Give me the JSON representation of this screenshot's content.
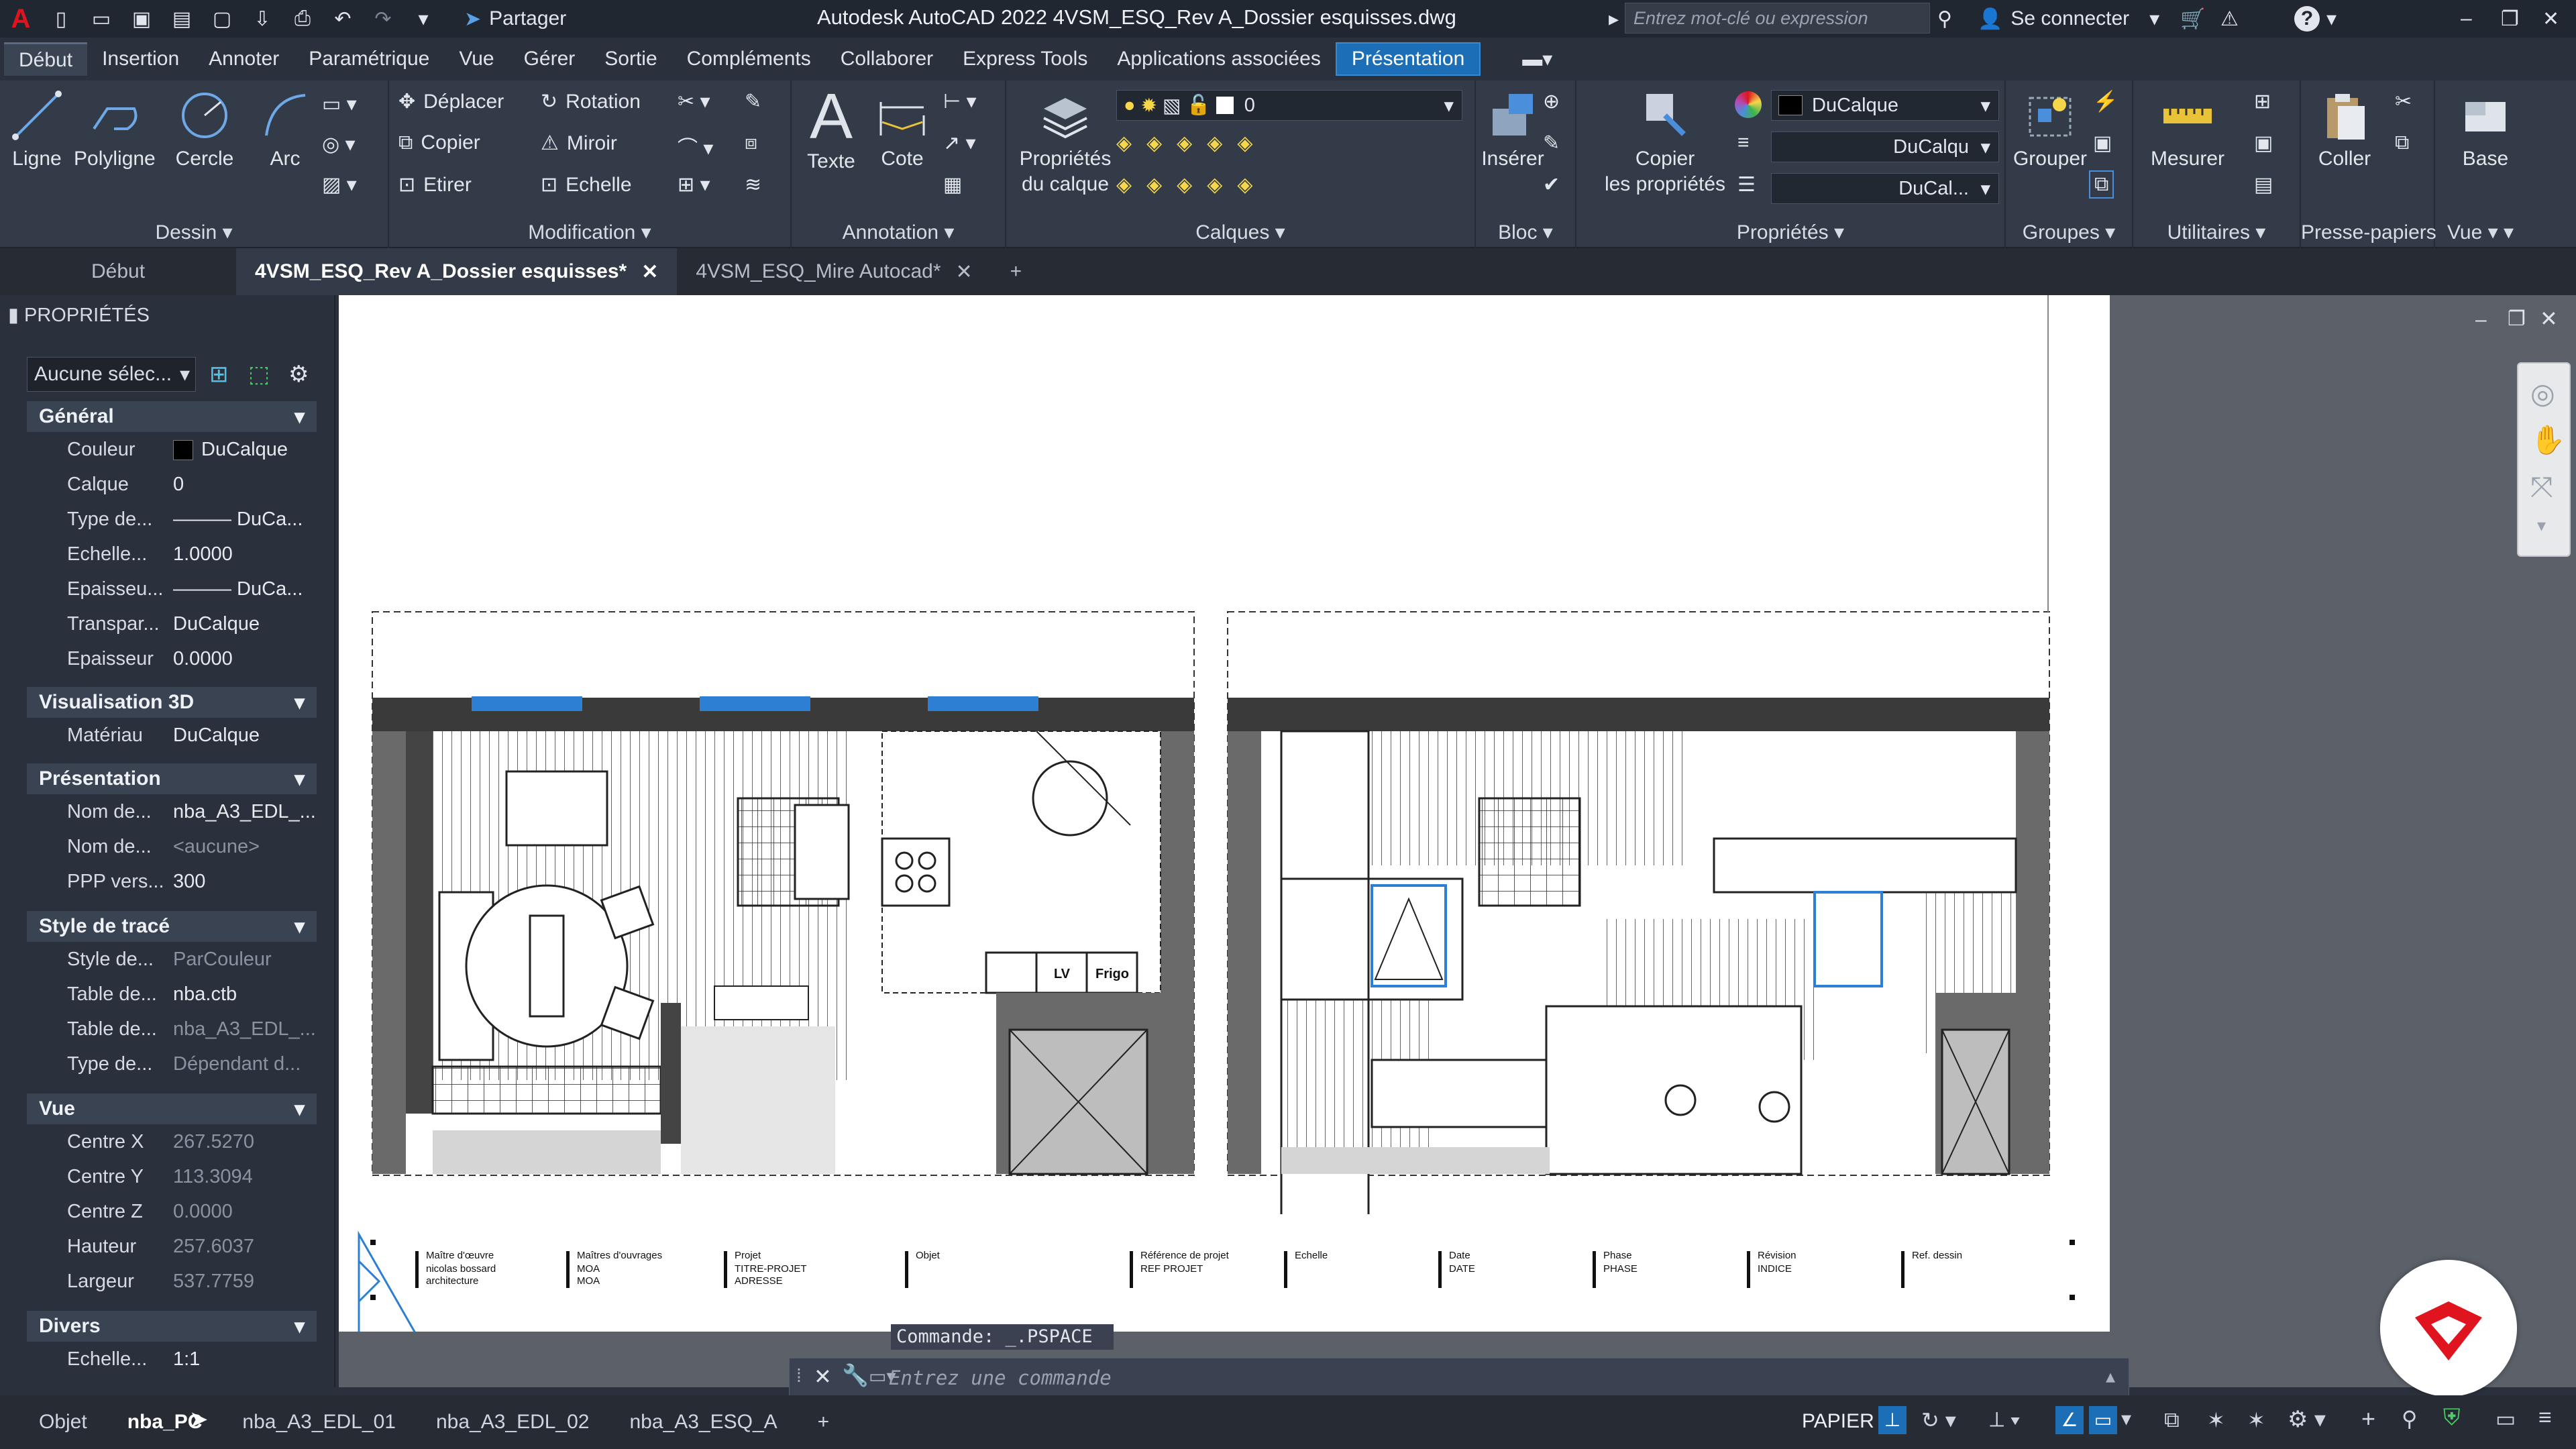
{
  "titlebar": {
    "app_title": "Autodesk AutoCAD 2022   4VSM_ESQ_Rev A_Dossier esquisses.dwg",
    "share_label": "Partager",
    "search_placeholder": "Entrez mot-clé ou expression",
    "signin_label": "Se connecter",
    "help_label": "?"
  },
  "menu_tabs": [
    "Début",
    "Insertion",
    "Annoter",
    "Paramétrique",
    "Vue",
    "Gérer",
    "Sortie",
    "Compléments",
    "Collaborer",
    "Express Tools",
    "Applications associées",
    "Présentation"
  ],
  "ribbon": {
    "dessin": {
      "title": "Dessin",
      "ligne": "Ligne",
      "polyligne": "Polyligne",
      "cercle": "Cercle",
      "arc": "Arc"
    },
    "modification": {
      "title": "Modification",
      "deplacer": "Déplacer",
      "rotation": "Rotation",
      "copier": "Copier",
      "miroir": "Miroir",
      "etirer": "Etirer",
      "echelle": "Echelle"
    },
    "annotation": {
      "title": "Annotation",
      "texte": "Texte",
      "cote": "Cote"
    },
    "calques": {
      "title": "Calques",
      "proprietes_line1": "Propriétés",
      "proprietes_line2": "du calque",
      "current_layer": "0"
    },
    "bloc": {
      "title": "Bloc",
      "inserer": "Insérer"
    },
    "proprietes": {
      "title": "Propriétés",
      "copier_line1": "Copier",
      "copier_line2": "les propriétés",
      "color_value": "DuCalque",
      "linetype_value": "DuCalqu",
      "lineweight_value": "DuCal..."
    },
    "groupes": {
      "title": "Groupes",
      "grouper": "Grouper"
    },
    "utilitaires": {
      "title": "Utilitaires",
      "mesurer": "Mesurer"
    },
    "presse_papiers": {
      "title": "Presse-papiers",
      "coller": "Coller"
    },
    "vue": {
      "title": "Vue",
      "base": "Base"
    }
  },
  "doc_tabs": {
    "start": "Début",
    "tab1": "4VSM_ESQ_Rev A_Dossier esquisses*",
    "tab2": "4VSM_ESQ_Mire Autocad*"
  },
  "properties": {
    "title": "PROPRIÉTÉS",
    "selection": "Aucune sélec...",
    "sections": {
      "general": "Général",
      "vis3d": "Visualisation 3D",
      "presentation": "Présentation",
      "style": "Style de tracé",
      "vue": "Vue",
      "divers": "Divers"
    },
    "general": [
      {
        "k": "Couleur",
        "v": "DuCalque"
      },
      {
        "k": "Calque",
        "v": "0"
      },
      {
        "k": "Type de...",
        "v": "——— DuCa..."
      },
      {
        "k": "Echelle...",
        "v": "1.0000"
      },
      {
        "k": "Epaisseu...",
        "v": "——— DuCa..."
      },
      {
        "k": "Transpar...",
        "v": "DuCalque"
      },
      {
        "k": "Epaisseur",
        "v": "0.0000"
      }
    ],
    "vis3d": [
      {
        "k": "Matériau",
        "v": "DuCalque"
      }
    ],
    "presentation": [
      {
        "k": "Nom de...",
        "v": "nba_A3_EDL_..."
      },
      {
        "k": "Nom de...",
        "v": "<aucune>"
      },
      {
        "k": "PPP vers...",
        "v": "300"
      }
    ],
    "style": [
      {
        "k": "Style de...",
        "v": "ParCouleur"
      },
      {
        "k": "Table de...",
        "v": "nba.ctb"
      },
      {
        "k": "Table de...",
        "v": "nba_A3_EDL_..."
      },
      {
        "k": "Type de...",
        "v": "Dépendant d..."
      }
    ],
    "vue": [
      {
        "k": "Centre X",
        "v": "267.5270"
      },
      {
        "k": "Centre Y",
        "v": "113.3094"
      },
      {
        "k": "Centre Z",
        "v": "0.0000"
      },
      {
        "k": "Hauteur",
        "v": "257.6037"
      },
      {
        "k": "Largeur",
        "v": "537.7759"
      }
    ],
    "divers": [
      {
        "k": "Echelle...",
        "v": "1:1"
      }
    ]
  },
  "drawing": {
    "titleblock": [
      {
        "h": "Maître d'œuvre",
        "l1": "nicolas bossard",
        "l2": "architecture"
      },
      {
        "h": "Maîtres d'ouvrages",
        "l1": "MOA",
        "l2": "MOA"
      },
      {
        "h": "Projet",
        "l1": "TITRE-PROJET",
        "l2": "ADRESSE"
      },
      {
        "h": "Objet",
        "l1": "",
        "l2": ""
      },
      {
        "h": "Référence de projet",
        "l1": "REF PROJET",
        "l2": ""
      },
      {
        "h": "Echelle",
        "l1": "",
        "l2": ""
      },
      {
        "h": "Date",
        "l1": "DATE",
        "l2": ""
      },
      {
        "h": "Phase",
        "l1": "PHASE",
        "l2": ""
      },
      {
        "h": "Révision",
        "l1": "INDICE",
        "l2": ""
      },
      {
        "h": "Ref. dessin",
        "l1": "",
        "l2": ""
      }
    ],
    "labels": {
      "lv": "LV",
      "frigo": "Frigo"
    }
  },
  "command": {
    "echo": "Commande: _.PSPACE",
    "placeholder": "Entrez une commande"
  },
  "layout_tabs": [
    "Objet",
    "nba_PC",
    "nba_A3_EDL_01",
    "nba_A3_EDL_02",
    "nba_A3_ESQ_A"
  ],
  "status": {
    "papier": "PAPIER"
  },
  "colors": {
    "accent": "#1c6fb7",
    "logo_red": "#e0141e",
    "ribbon_bg": "#333b48"
  }
}
